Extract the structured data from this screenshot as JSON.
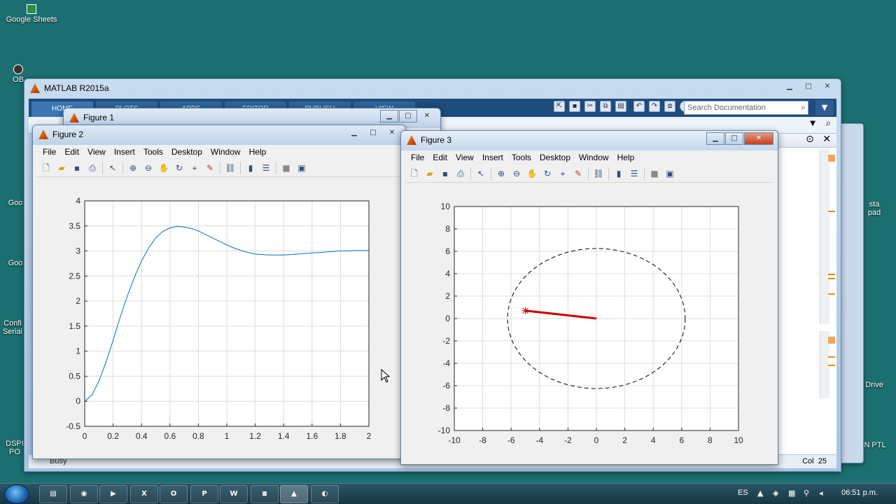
{
  "desktop": {
    "icons": [
      {
        "label": "Google Sheets"
      },
      {
        "label": "OB"
      },
      {
        "label": "Goo"
      },
      {
        "label": "Goo"
      },
      {
        "label": "Confi Serial"
      },
      {
        "label": "DSPI PO"
      },
      {
        "label": "sta pad"
      },
      {
        "label": "Drive"
      },
      {
        "label": "N PTL"
      }
    ]
  },
  "matlab": {
    "title": "MATLAB R2015a",
    "ribbon_tabs": [
      "HOME",
      "PLOTS",
      "APPS",
      "EDITOR",
      "PUBLISH",
      "VIEW"
    ],
    "search_placeholder": "Search Documentation",
    "status": "Busy",
    "col_label": "Col",
    "col_value": "25"
  },
  "figure1": {
    "title": "Figure 1"
  },
  "figure2": {
    "title": "Figure 2",
    "menu": [
      "File",
      "Edit",
      "View",
      "Insert",
      "Tools",
      "Desktop",
      "Window",
      "Help"
    ]
  },
  "figure3": {
    "title": "Figure 3",
    "menu": [
      "File",
      "Edit",
      "View",
      "Insert",
      "Tools",
      "Desktop",
      "Window",
      "Help"
    ]
  },
  "toolbar_icons": [
    "new-file-icon",
    "open-file-icon",
    "save-icon",
    "print-icon",
    "pointer-icon",
    "zoom-in-icon",
    "zoom-out-icon",
    "pan-icon",
    "rotate-icon",
    "data-cursor-icon",
    "brush-icon",
    "link-plot-icon",
    "colorbar-icon",
    "legend-icon",
    "hide-plot-tools-icon",
    "show-plot-tools-icon"
  ],
  "taskbar": {
    "apps": [
      "explorer",
      "chrome",
      "media",
      "X",
      "O",
      "P",
      "W",
      "device",
      "matlab",
      "other"
    ],
    "language": "ES",
    "clock": "06:51 p.m."
  },
  "chart_data": [
    {
      "type": "line",
      "title": "",
      "xlabel": "",
      "ylabel": "",
      "xlim": [
        0,
        2
      ],
      "ylim": [
        -0.5,
        4
      ],
      "xticks": [
        "0",
        "0.2",
        "0.4",
        "0.6",
        "0.8",
        "1",
        "1.2",
        "1.4",
        "1.6",
        "1.8",
        "2"
      ],
      "yticks": [
        "-0.5",
        "0",
        "0.5",
        "1",
        "1.5",
        "2",
        "2.5",
        "3",
        "3.5",
        "4"
      ],
      "grid": true,
      "color": "#0072bd",
      "x": [
        0,
        0.05,
        0.1,
        0.15,
        0.2,
        0.25,
        0.3,
        0.35,
        0.4,
        0.45,
        0.5,
        0.55,
        0.6,
        0.65,
        0.7,
        0.75,
        0.8,
        0.85,
        0.9,
        0.95,
        1.0,
        1.05,
        1.1,
        1.15,
        1.2,
        1.25,
        1.3,
        1.35,
        1.4,
        1.45,
        1.5,
        1.55,
        1.6,
        1.65,
        1.7,
        1.75,
        1.8,
        1.85,
        1.9,
        1.95,
        2.0
      ],
      "y": [
        0,
        0.12,
        0.4,
        0.78,
        1.22,
        1.68,
        2.1,
        2.48,
        2.8,
        3.06,
        3.26,
        3.39,
        3.46,
        3.49,
        3.48,
        3.45,
        3.4,
        3.33,
        3.26,
        3.19,
        3.12,
        3.06,
        3.01,
        2.97,
        2.94,
        2.93,
        2.92,
        2.92,
        2.92,
        2.93,
        2.94,
        2.95,
        2.96,
        2.97,
        2.98,
        2.99,
        3.0,
        3.0,
        3.01,
        3.01,
        3.01
      ]
    },
    {
      "type": "scatter",
      "title": "",
      "xlabel": "",
      "ylabel": "",
      "xlim": [
        -10,
        10
      ],
      "ylim": [
        -10,
        10
      ],
      "xticks": [
        "-10",
        "-8",
        "-6",
        "-4",
        "-2",
        "0",
        "2",
        "4",
        "6",
        "8",
        "10"
      ],
      "yticks": [
        "-10",
        "-8",
        "-6",
        "-4",
        "-2",
        "0",
        "2",
        "4",
        "6",
        "8",
        "10"
      ],
      "grid": true,
      "series": [
        {
          "style": "dashed-circle",
          "color": "#000000",
          "center": [
            0,
            0
          ],
          "radius_x": 6.25,
          "radius_y": 6.25
        },
        {
          "style": "line",
          "color": "#cc0000",
          "x": [
            0,
            -5
          ],
          "y": [
            0,
            0.7
          ]
        },
        {
          "style": "marker-star",
          "color": "#cc0000",
          "x": [
            -5
          ],
          "y": [
            0.7
          ]
        }
      ]
    }
  ]
}
